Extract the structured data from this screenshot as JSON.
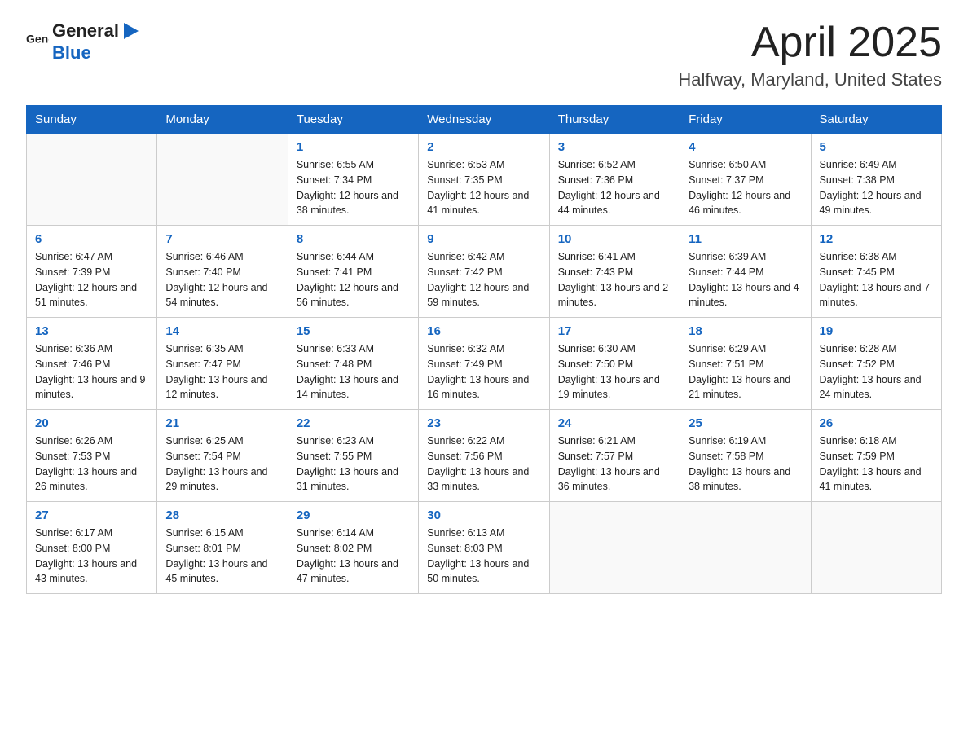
{
  "header": {
    "logo_general": "General",
    "logo_blue": "Blue",
    "month_title": "April 2025",
    "location": "Halfway, Maryland, United States"
  },
  "weekdays": [
    "Sunday",
    "Monday",
    "Tuesday",
    "Wednesday",
    "Thursday",
    "Friday",
    "Saturday"
  ],
  "weeks": [
    [
      {
        "day": "",
        "sunrise": "",
        "sunset": "",
        "daylight": ""
      },
      {
        "day": "",
        "sunrise": "",
        "sunset": "",
        "daylight": ""
      },
      {
        "day": "1",
        "sunrise": "Sunrise: 6:55 AM",
        "sunset": "Sunset: 7:34 PM",
        "daylight": "Daylight: 12 hours and 38 minutes."
      },
      {
        "day": "2",
        "sunrise": "Sunrise: 6:53 AM",
        "sunset": "Sunset: 7:35 PM",
        "daylight": "Daylight: 12 hours and 41 minutes."
      },
      {
        "day": "3",
        "sunrise": "Sunrise: 6:52 AM",
        "sunset": "Sunset: 7:36 PM",
        "daylight": "Daylight: 12 hours and 44 minutes."
      },
      {
        "day": "4",
        "sunrise": "Sunrise: 6:50 AM",
        "sunset": "Sunset: 7:37 PM",
        "daylight": "Daylight: 12 hours and 46 minutes."
      },
      {
        "day": "5",
        "sunrise": "Sunrise: 6:49 AM",
        "sunset": "Sunset: 7:38 PM",
        "daylight": "Daylight: 12 hours and 49 minutes."
      }
    ],
    [
      {
        "day": "6",
        "sunrise": "Sunrise: 6:47 AM",
        "sunset": "Sunset: 7:39 PM",
        "daylight": "Daylight: 12 hours and 51 minutes."
      },
      {
        "day": "7",
        "sunrise": "Sunrise: 6:46 AM",
        "sunset": "Sunset: 7:40 PM",
        "daylight": "Daylight: 12 hours and 54 minutes."
      },
      {
        "day": "8",
        "sunrise": "Sunrise: 6:44 AM",
        "sunset": "Sunset: 7:41 PM",
        "daylight": "Daylight: 12 hours and 56 minutes."
      },
      {
        "day": "9",
        "sunrise": "Sunrise: 6:42 AM",
        "sunset": "Sunset: 7:42 PM",
        "daylight": "Daylight: 12 hours and 59 minutes."
      },
      {
        "day": "10",
        "sunrise": "Sunrise: 6:41 AM",
        "sunset": "Sunset: 7:43 PM",
        "daylight": "Daylight: 13 hours and 2 minutes."
      },
      {
        "day": "11",
        "sunrise": "Sunrise: 6:39 AM",
        "sunset": "Sunset: 7:44 PM",
        "daylight": "Daylight: 13 hours and 4 minutes."
      },
      {
        "day": "12",
        "sunrise": "Sunrise: 6:38 AM",
        "sunset": "Sunset: 7:45 PM",
        "daylight": "Daylight: 13 hours and 7 minutes."
      }
    ],
    [
      {
        "day": "13",
        "sunrise": "Sunrise: 6:36 AM",
        "sunset": "Sunset: 7:46 PM",
        "daylight": "Daylight: 13 hours and 9 minutes."
      },
      {
        "day": "14",
        "sunrise": "Sunrise: 6:35 AM",
        "sunset": "Sunset: 7:47 PM",
        "daylight": "Daylight: 13 hours and 12 minutes."
      },
      {
        "day": "15",
        "sunrise": "Sunrise: 6:33 AM",
        "sunset": "Sunset: 7:48 PM",
        "daylight": "Daylight: 13 hours and 14 minutes."
      },
      {
        "day": "16",
        "sunrise": "Sunrise: 6:32 AM",
        "sunset": "Sunset: 7:49 PM",
        "daylight": "Daylight: 13 hours and 16 minutes."
      },
      {
        "day": "17",
        "sunrise": "Sunrise: 6:30 AM",
        "sunset": "Sunset: 7:50 PM",
        "daylight": "Daylight: 13 hours and 19 minutes."
      },
      {
        "day": "18",
        "sunrise": "Sunrise: 6:29 AM",
        "sunset": "Sunset: 7:51 PM",
        "daylight": "Daylight: 13 hours and 21 minutes."
      },
      {
        "day": "19",
        "sunrise": "Sunrise: 6:28 AM",
        "sunset": "Sunset: 7:52 PM",
        "daylight": "Daylight: 13 hours and 24 minutes."
      }
    ],
    [
      {
        "day": "20",
        "sunrise": "Sunrise: 6:26 AM",
        "sunset": "Sunset: 7:53 PM",
        "daylight": "Daylight: 13 hours and 26 minutes."
      },
      {
        "day": "21",
        "sunrise": "Sunrise: 6:25 AM",
        "sunset": "Sunset: 7:54 PM",
        "daylight": "Daylight: 13 hours and 29 minutes."
      },
      {
        "day": "22",
        "sunrise": "Sunrise: 6:23 AM",
        "sunset": "Sunset: 7:55 PM",
        "daylight": "Daylight: 13 hours and 31 minutes."
      },
      {
        "day": "23",
        "sunrise": "Sunrise: 6:22 AM",
        "sunset": "Sunset: 7:56 PM",
        "daylight": "Daylight: 13 hours and 33 minutes."
      },
      {
        "day": "24",
        "sunrise": "Sunrise: 6:21 AM",
        "sunset": "Sunset: 7:57 PM",
        "daylight": "Daylight: 13 hours and 36 minutes."
      },
      {
        "day": "25",
        "sunrise": "Sunrise: 6:19 AM",
        "sunset": "Sunset: 7:58 PM",
        "daylight": "Daylight: 13 hours and 38 minutes."
      },
      {
        "day": "26",
        "sunrise": "Sunrise: 6:18 AM",
        "sunset": "Sunset: 7:59 PM",
        "daylight": "Daylight: 13 hours and 41 minutes."
      }
    ],
    [
      {
        "day": "27",
        "sunrise": "Sunrise: 6:17 AM",
        "sunset": "Sunset: 8:00 PM",
        "daylight": "Daylight: 13 hours and 43 minutes."
      },
      {
        "day": "28",
        "sunrise": "Sunrise: 6:15 AM",
        "sunset": "Sunset: 8:01 PM",
        "daylight": "Daylight: 13 hours and 45 minutes."
      },
      {
        "day": "29",
        "sunrise": "Sunrise: 6:14 AM",
        "sunset": "Sunset: 8:02 PM",
        "daylight": "Daylight: 13 hours and 47 minutes."
      },
      {
        "day": "30",
        "sunrise": "Sunrise: 6:13 AM",
        "sunset": "Sunset: 8:03 PM",
        "daylight": "Daylight: 13 hours and 50 minutes."
      },
      {
        "day": "",
        "sunrise": "",
        "sunset": "",
        "daylight": ""
      },
      {
        "day": "",
        "sunrise": "",
        "sunset": "",
        "daylight": ""
      },
      {
        "day": "",
        "sunrise": "",
        "sunset": "",
        "daylight": ""
      }
    ]
  ]
}
